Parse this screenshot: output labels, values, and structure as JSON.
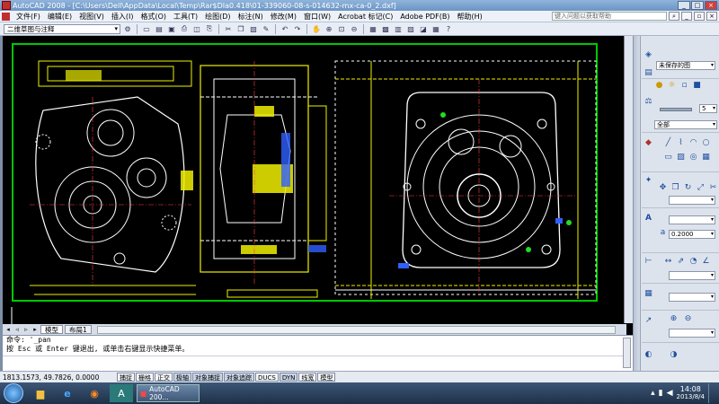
{
  "window": {
    "title": "AutoCAD 2008 - [C:\\Users\\Dell\\AppData\\Local\\Temp\\Rar$DIa0.418\\01-339060-08-s-014632-mx-ca-0_2.dxf]",
    "controls": [
      "_",
      "□",
      "×"
    ]
  },
  "menu": {
    "items": [
      "文件(F)",
      "编辑(E)",
      "视图(V)",
      "插入(I)",
      "格式(O)",
      "工具(T)",
      "绘图(D)",
      "标注(N)",
      "修改(M)",
      "窗口(W)",
      "Acrobat 标记(C)",
      "Adobe PDF(B)",
      "帮助(H)"
    ],
    "help_placeholder": "键入问题以获取帮助"
  },
  "toolbar": {
    "workspace": "二维草图与注释"
  },
  "layout_tabs": [
    "模型",
    "布局1"
  ],
  "palette": {
    "layer_state": "未保存的图",
    "layer_color": "5",
    "scale_label": "全部",
    "lineweight_value": "0.2000"
  },
  "command": {
    "line1": "命令: '_pan",
    "line2": "按 Esc 或 Enter 键退出, 或单击右键显示快捷菜单。",
    "prompt": ""
  },
  "status": {
    "coords": "1813.1573,  49.7826,  0.0000",
    "toggles": [
      {
        "label": "捕捉",
        "on": false
      },
      {
        "label": "栅格",
        "on": false
      },
      {
        "label": "正交",
        "on": false
      },
      {
        "label": "极轴",
        "on": true
      },
      {
        "label": "对象捕捉",
        "on": true
      },
      {
        "label": "对象追踪",
        "on": true
      },
      {
        "label": "DUCS",
        "on": false
      },
      {
        "label": "DYN",
        "on": true
      },
      {
        "label": "线宽",
        "on": false
      },
      {
        "label": "模型",
        "on": false
      }
    ]
  },
  "taskbar": {
    "task_label": "AutoCAD 200...",
    "time": "14:08",
    "date": "2013/8/4"
  },
  "colors": {
    "drawing_yellow": "#f0f000",
    "drawing_white": "#ffffff",
    "drawing_green": "#22dd22",
    "drawing_blue": "#3060ff",
    "border_green": "#00c800"
  }
}
